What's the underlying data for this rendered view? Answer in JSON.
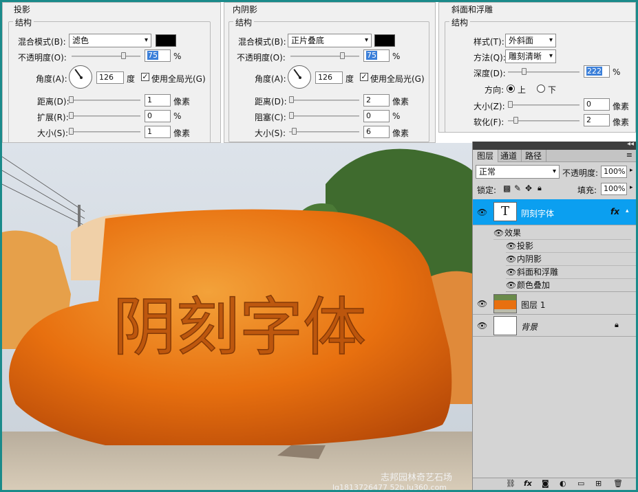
{
  "drop_shadow": {
    "title": "投影",
    "group": "结构",
    "blend_label": "混合模式(B):",
    "blend_value": "滤色",
    "opacity_label": "不透明度(O):",
    "opacity_value": "75",
    "opacity_unit": "%",
    "angle_label": "角度(A):",
    "angle_value": "126",
    "angle_unit": "度",
    "global_light": "使用全局光(G)",
    "distance_label": "距离(D):",
    "distance_value": "1",
    "distance_unit": "像素",
    "spread_label": "扩展(R):",
    "spread_value": "0",
    "spread_unit": "%",
    "size_label": "大小(S):",
    "size_value": "1",
    "size_unit": "像素"
  },
  "inner_shadow": {
    "title": "内阴影",
    "group": "结构",
    "blend_label": "混合模式(B):",
    "blend_value": "正片叠底",
    "opacity_label": "不透明度(O):",
    "opacity_value": "75",
    "opacity_unit": "%",
    "angle_label": "角度(A):",
    "angle_value": "126",
    "angle_unit": "度",
    "global_light": "使用全局光(G)",
    "distance_label": "距离(D):",
    "distance_value": "2",
    "distance_unit": "像素",
    "choke_label": "阻塞(C):",
    "choke_value": "0",
    "choke_unit": "%",
    "size_label": "大小(S):",
    "size_value": "6",
    "size_unit": "像素"
  },
  "bevel": {
    "title": "斜面和浮雕",
    "group": "结构",
    "style_label": "样式(T):",
    "style_value": "外斜面",
    "technique_label": "方法(Q):",
    "technique_value": "雕刻清晰",
    "depth_label": "深度(D):",
    "depth_value": "222",
    "depth_unit": "%",
    "direction_label": "方向:",
    "dir_up": "上",
    "dir_down": "下",
    "size_label": "大小(Z):",
    "size_value": "0",
    "size_unit": "像素",
    "soften_label": "软化(F):",
    "soften_value": "2",
    "soften_unit": "像素"
  },
  "image": {
    "carved_text": "阴刻字体",
    "watermark_1": "志邦园林奇艺石场",
    "watermark_2": "lq1813726477 52b.lu360.com"
  },
  "layers": {
    "tab_layers": "图层",
    "tab_channels": "通道",
    "tab_paths": "路径",
    "blend_mode": "正常",
    "opacity_label": "不透明度:",
    "opacity_value": "100%",
    "lock_label": "锁定:",
    "fill_label": "填充:",
    "fill_value": "100%",
    "text_layer_name": "阴刻字体",
    "text_thumb": "T",
    "fx_label": "fx",
    "effects_label": "效果",
    "effects": [
      "投影",
      "内阴影",
      "斜面和浮雕",
      "颜色叠加"
    ],
    "layer1_name": "图层 1",
    "background_name": "背景"
  },
  "colors": {
    "selection": "#0b9ff0",
    "rock": "#e8700f"
  }
}
